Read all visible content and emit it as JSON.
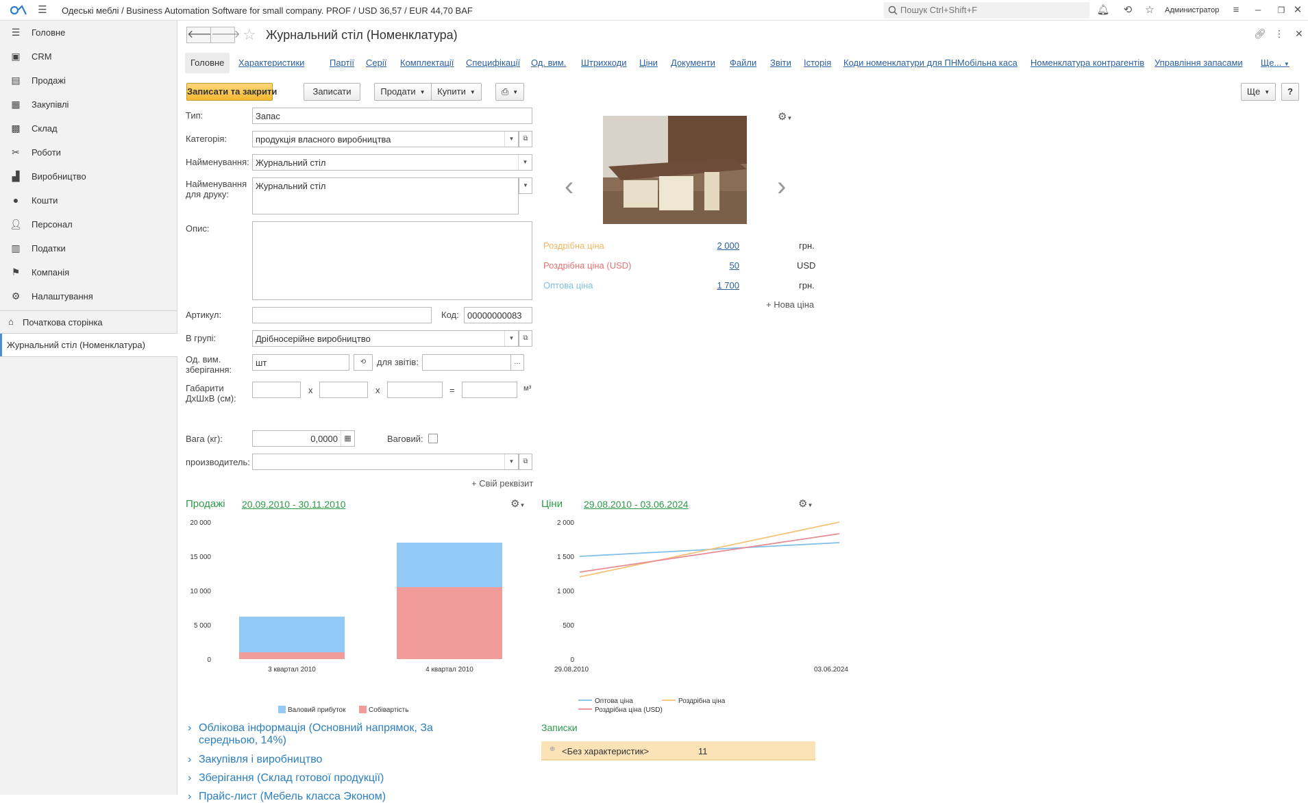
{
  "topbar": {
    "title": "Одеські меблі / Business Automation Software for small company. PROF / USD 36,57 / EUR 44,70 BAF",
    "search_placeholder": "Пошук Ctrl+Shift+F",
    "user": "Администратор"
  },
  "sidebar": {
    "items": [
      {
        "label": "Головне",
        "icon": "menu-icon"
      },
      {
        "label": "CRM",
        "icon": "crm-icon"
      },
      {
        "label": "Продажі",
        "icon": "sales-icon"
      },
      {
        "label": "Закупівлі",
        "icon": "purchases-icon"
      },
      {
        "label": "Склад",
        "icon": "warehouse-icon"
      },
      {
        "label": "Роботи",
        "icon": "tools-icon"
      },
      {
        "label": "Виробництво",
        "icon": "production-icon"
      },
      {
        "label": "Кошти",
        "icon": "money-icon"
      },
      {
        "label": "Персонал",
        "icon": "staff-icon"
      },
      {
        "label": "Податки",
        "icon": "taxes-icon"
      },
      {
        "label": "Компанія",
        "icon": "flag-icon"
      },
      {
        "label": "Налаштування",
        "icon": "gear-icon"
      }
    ],
    "home": "Початкова сторінка",
    "open_doc": "Журнальний стіл (Номенклатура)"
  },
  "form": {
    "title": "Журнальний стіл (Номенклатура)",
    "tabs": [
      "Головне",
      "Характеристики",
      "Партії",
      "Серії",
      "Комплектації",
      "Специфікації",
      "Од. вим.",
      "Штрихкоди",
      "Ціни",
      "Документи",
      "Файли",
      "Звіти",
      "Історія",
      "Коди номенклатури для ПН",
      "Мобільна каса",
      "Номенклатура контрагентів",
      "Управління запасами",
      "Ще..."
    ],
    "buttons": {
      "save_close": "Записати та закрити",
      "save": "Записати",
      "sell": "Продати",
      "buy": "Купити",
      "more": "Ще",
      "help": "?"
    },
    "fields": {
      "type_label": "Тип:",
      "type_value": "Запас",
      "category_label": "Категорія:",
      "category_value": "продукція власного виробництва",
      "name_label": "Найменування:",
      "name_value": "Журнальний стіл",
      "print_name_label": "Найменування для друку:",
      "print_name_value": "Журнальний стіл",
      "description_label": "Опис:",
      "description_value": "",
      "article_label": "Артикул:",
      "article_value": "",
      "code_label": "Код:",
      "code_value": "00000000083",
      "group_label": "В групі:",
      "group_value": "Дрібносерійне виробництво",
      "unit_label": "Од. вим. зберігання:",
      "unit_value": "шт",
      "reports_label": "для звітів:",
      "reports_value": "",
      "dims_label": "Габарити ДхШхВ (см):",
      "dims_x": "x",
      "dims_eq": "=",
      "dims_unit": "м³",
      "weight_label": "Вага (кг):",
      "weight_value": "0,0000",
      "weighted_label": "Ваговий:",
      "manufacturer_label": "производитель:",
      "manufacturer_value": "",
      "own_attr": "+ Свій реквізит"
    },
    "prices": [
      {
        "label": "Роздрібна ціна",
        "value": "2 000",
        "currency": "грн.",
        "color": "#f2b866"
      },
      {
        "label": "Роздрібна ціна  (USD)",
        "value": "50",
        "currency": "USD",
        "color": "#e57373"
      },
      {
        "label": "Оптова ціна",
        "value": "1 700",
        "currency": "грн.",
        "color": "#7fbfe8"
      }
    ],
    "new_price": "+ Нова ціна",
    "sections": [
      "Облікова інформація (Основний напрямок, За середньою, 14%)",
      "Закупівля і виробництво",
      "Зберігання (Склад готової продукції)",
      "Прайс-лист (Мебель класса Эконом)"
    ],
    "notes": {
      "title": "Записки",
      "row_label": "<Без характеристик>",
      "row_value": "11"
    }
  },
  "sales_chart": {
    "title": "Продажі",
    "period": "20.09.2010 - 30.11.2010"
  },
  "prices_chart": {
    "title": "Ціни",
    "period": "29.08.2010 - 03.06.2024"
  },
  "chart_data": [
    {
      "type": "bar",
      "categories": [
        "3 квартал 2010",
        "4 квартал 2010"
      ],
      "series": [
        {
          "name": "Собівартість",
          "values": [
            1000,
            10500
          ],
          "color": "#f29b9b"
        },
        {
          "name": "Валовий прибуток",
          "values": [
            5200,
            6500
          ],
          "color": "#92c9f5"
        }
      ],
      "stacked": true,
      "ylim": [
        0,
        20000
      ],
      "yticks": [
        "0",
        "5 000",
        "10 000",
        "15 000",
        "20 000"
      ],
      "legend": "bottom"
    },
    {
      "type": "line",
      "x": [
        "29.08.2010",
        "03.06.2024"
      ],
      "series": [
        {
          "name": "Оптова ціна",
          "values": [
            1500,
            1700
          ],
          "color": "#7fbfe8"
        },
        {
          "name": "Роздрібна ціна",
          "values": [
            1200,
            2000
          ],
          "color": "#f5c27a"
        },
        {
          "name": "Роздрібна ціна  (USD)",
          "values": [
            1270,
            1830
          ],
          "color": "#e88a96"
        }
      ],
      "ylim": [
        0,
        2000
      ],
      "yticks": [
        "0",
        "500",
        "1 000",
        "1 500",
        "2 000"
      ],
      "legend": "bottom"
    }
  ]
}
